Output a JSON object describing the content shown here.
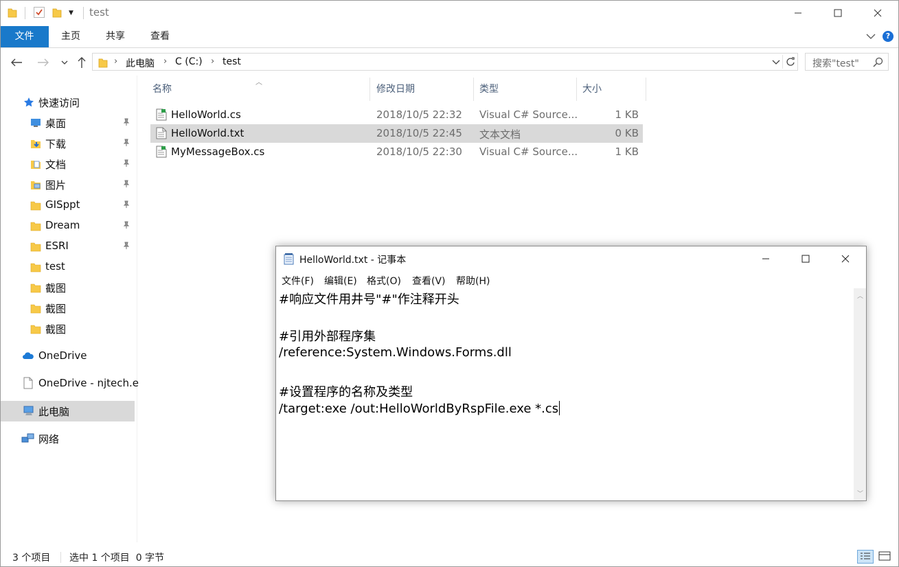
{
  "titlebar": {
    "title": "test"
  },
  "ribbon": {
    "tabs": [
      "文件",
      "主页",
      "共享",
      "查看"
    ]
  },
  "address": {
    "parts": [
      "此电脑",
      "C (C:)",
      "test"
    ],
    "search_placeholder": "搜索\"test\""
  },
  "navpane": {
    "quick_access": "快速访问",
    "items": [
      "桌面",
      "下载",
      "文档",
      "图片",
      "GISppt",
      "Dream",
      "ESRI",
      "test",
      "截图",
      "截图",
      "截图"
    ],
    "onedrive": "OneDrive",
    "onedrive_org": "OneDrive - njtech.e",
    "this_pc": "此电脑",
    "network": "网络"
  },
  "filelist": {
    "columns": [
      "名称",
      "修改日期",
      "类型",
      "大小"
    ],
    "rows": [
      {
        "name": "HelloWorld.cs",
        "date": "2018/10/5 22:32",
        "type": "Visual C# Source...",
        "size": "1 KB"
      },
      {
        "name": "HelloWorld.txt",
        "date": "2018/10/5 22:45",
        "type": "文本文档",
        "size": "0 KB"
      },
      {
        "name": "MyMessageBox.cs",
        "date": "2018/10/5 22:30",
        "type": "Visual C# Source...",
        "size": "1 KB"
      }
    ]
  },
  "status": {
    "count": "3 个项目",
    "selection": "选中 1 个项目  0 字节"
  },
  "notepad": {
    "title": "HelloWorld.txt - 记事本",
    "menu": [
      "文件(F)",
      "编辑(E)",
      "格式(O)",
      "查看(V)",
      "帮助(H)"
    ],
    "lines": [
      "#响应文件用井号\"#\"作注释开头",
      "",
      "#引用外部程序集",
      "/reference:System.Windows.Forms.dll",
      "",
      "#设置程序的名称及类型",
      "/target:exe /out:HelloWorldByRspFile.exe *.cs"
    ]
  },
  "colors": {
    "ribbon_file_tab": "#1979ca",
    "selection": "#d9d9d9",
    "folder": "#f7c948"
  }
}
